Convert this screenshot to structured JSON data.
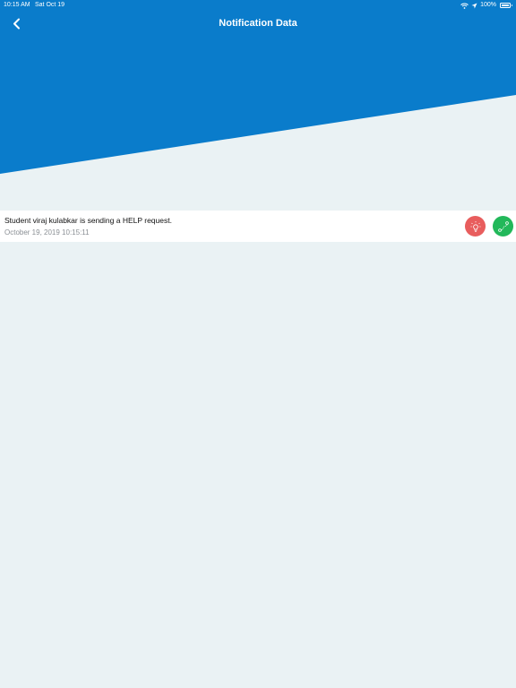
{
  "status_bar": {
    "time": "10:15 AM",
    "date": "Sat Oct 19",
    "battery": "100%",
    "icons": [
      "wifi-icon",
      "location-arrow-icon",
      "battery-icon"
    ]
  },
  "header": {
    "title": "Notification Data",
    "back_icon": "chevron-left-icon"
  },
  "notifications": [
    {
      "message": "Student viraj kulabkar is sending a HELP request.",
      "timestamp": "October 19, 2019 10:15:11",
      "actions": [
        {
          "icon": "lightbulb-icon",
          "color": "#e85d5d"
        },
        {
          "icon": "route-icon",
          "color": "#22b85a"
        }
      ]
    }
  ],
  "colors": {
    "header_blue": "#0a7ccb",
    "background": "#eaf2f4"
  }
}
